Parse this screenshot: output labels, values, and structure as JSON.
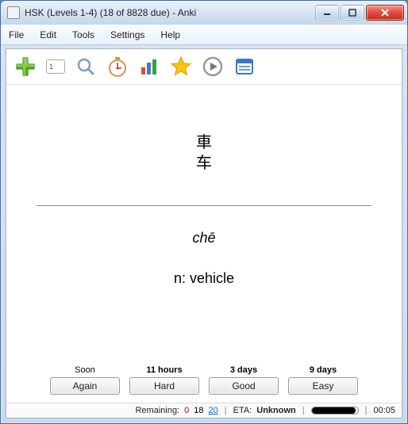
{
  "window": {
    "title": "HSK (Levels 1-4) (18 of 8828 due) - Anki"
  },
  "menu": {
    "file": "File",
    "edit": "Edit",
    "tools": "Tools",
    "settings": "Settings",
    "help": "Help"
  },
  "toolbar": {
    "counter": "1"
  },
  "card": {
    "hanzi_trad": "車",
    "hanzi_simp": "车",
    "pinyin": "chē",
    "meaning": "n: vehicle"
  },
  "answers": {
    "again": {
      "interval": "Soon",
      "label": "Again"
    },
    "hard": {
      "interval": "11 hours",
      "label": "Hard"
    },
    "good": {
      "interval": "3 days",
      "label": "Good"
    },
    "easy": {
      "interval": "9 days",
      "label": "Easy"
    }
  },
  "status": {
    "remaining_label": "Remaining:",
    "remaining_new": "0",
    "remaining_learn": "18",
    "remaining_review": "20",
    "eta_label": "ETA:",
    "eta_value": "Unknown",
    "time": "00:05"
  }
}
